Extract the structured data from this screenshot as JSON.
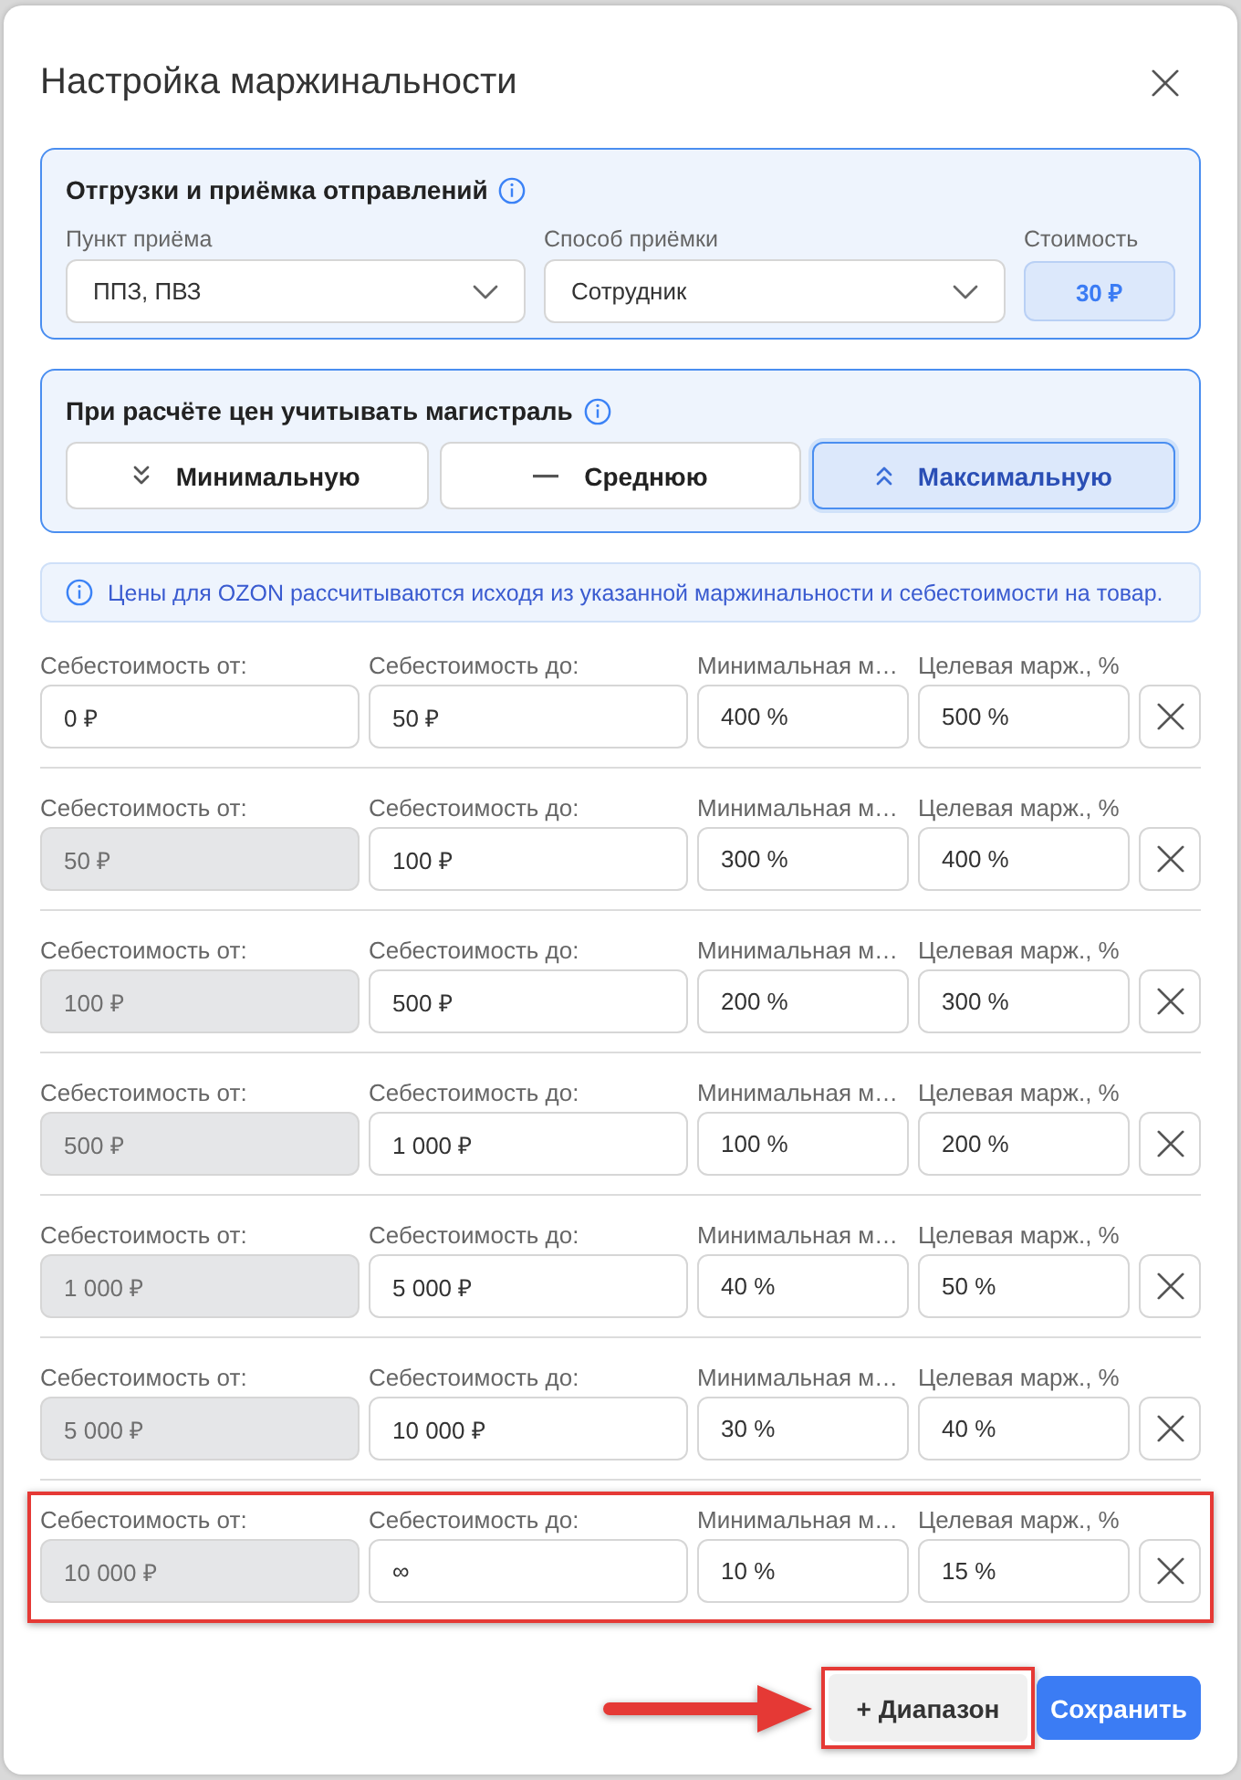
{
  "dialog": {
    "title": "Настройка маржинальности"
  },
  "shipping": {
    "title": "Отгрузки и приёмка отправлений",
    "fields": [
      {
        "kind": "select",
        "label": "Пункт приёма",
        "value": "ППЗ, ПВЗ"
      },
      {
        "kind": "select",
        "label": "Способ приёмки",
        "value": "Сотрудник"
      },
      {
        "kind": "readout",
        "label": "Стоимость",
        "value": "30 ₽"
      }
    ]
  },
  "trunk": {
    "title": "При расчёте цен учитывать магистраль",
    "options": [
      {
        "kind": "min",
        "label": "Минимальную",
        "selected": false
      },
      {
        "kind": "mid",
        "label": "Среднюю",
        "selected": false
      },
      {
        "kind": "max",
        "label": "Максимальную",
        "selected": true
      }
    ]
  },
  "notice": {
    "text": "Цены для OZON рассчитываются исходя из указанной маржинальности и себестоимости на товар."
  },
  "rows": [
    {
      "highlighted": false,
      "fields": [
        {
          "label": "Себестоимость от:",
          "value": "0 ₽",
          "disabled": false
        },
        {
          "label": "Себестоимость до:",
          "value": "50 ₽",
          "disabled": false
        },
        {
          "label": "Минимальная м…",
          "value": "400 %",
          "disabled": false
        },
        {
          "label": "Целевая марж., %",
          "value": "500 %",
          "disabled": false
        }
      ]
    },
    {
      "highlighted": false,
      "fields": [
        {
          "label": "Себестоимость от:",
          "value": "50 ₽",
          "disabled": true
        },
        {
          "label": "Себестоимость до:",
          "value": "100 ₽",
          "disabled": false
        },
        {
          "label": "Минимальная м…",
          "value": "300 %",
          "disabled": false
        },
        {
          "label": "Целевая марж., %",
          "value": "400 %",
          "disabled": false
        }
      ]
    },
    {
      "highlighted": false,
      "fields": [
        {
          "label": "Себестоимость от:",
          "value": "100 ₽",
          "disabled": true
        },
        {
          "label": "Себестоимость до:",
          "value": "500 ₽",
          "disabled": false
        },
        {
          "label": "Минимальная м…",
          "value": "200 %",
          "disabled": false
        },
        {
          "label": "Целевая марж., %",
          "value": "300 %",
          "disabled": false
        }
      ]
    },
    {
      "highlighted": false,
      "fields": [
        {
          "label": "Себестоимость от:",
          "value": "500 ₽",
          "disabled": true
        },
        {
          "label": "Себестоимость до:",
          "value": "1 000 ₽",
          "disabled": false
        },
        {
          "label": "Минимальная м…",
          "value": "100 %",
          "disabled": false
        },
        {
          "label": "Целевая марж., %",
          "value": "200 %",
          "disabled": false
        }
      ]
    },
    {
      "highlighted": false,
      "fields": [
        {
          "label": "Себестоимость от:",
          "value": "1 000 ₽",
          "disabled": true
        },
        {
          "label": "Себестоимость до:",
          "value": "5 000 ₽",
          "disabled": false
        },
        {
          "label": "Минимальная м…",
          "value": "40 %",
          "disabled": false
        },
        {
          "label": "Целевая марж., %",
          "value": "50 %",
          "disabled": false
        }
      ]
    },
    {
      "highlighted": false,
      "fields": [
        {
          "label": "Себестоимость от:",
          "value": "5 000 ₽",
          "disabled": true
        },
        {
          "label": "Себестоимость до:",
          "value": "10 000 ₽",
          "disabled": false
        },
        {
          "label": "Минимальная м…",
          "value": "30 %",
          "disabled": false
        },
        {
          "label": "Целевая марж., %",
          "value": "40 %",
          "disabled": false
        }
      ]
    },
    {
      "highlighted": true,
      "fields": [
        {
          "label": "Себестоимость от:",
          "value": "10 000 ₽",
          "disabled": true
        },
        {
          "label": "Себестоимость до:",
          "value": "∞",
          "disabled": false
        },
        {
          "label": "Минимальная м…",
          "value": "10 %",
          "disabled": false
        },
        {
          "label": "Целевая марж., %",
          "value": "15 %",
          "disabled": false
        }
      ]
    }
  ],
  "footer": {
    "buttons": [
      {
        "kind": "secondary",
        "label": "+ Диапазон",
        "highlighted": true,
        "pointed_at": true
      },
      {
        "kind": "primary",
        "label": "Сохранить",
        "highlighted": false,
        "pointed_at": false
      }
    ]
  }
}
